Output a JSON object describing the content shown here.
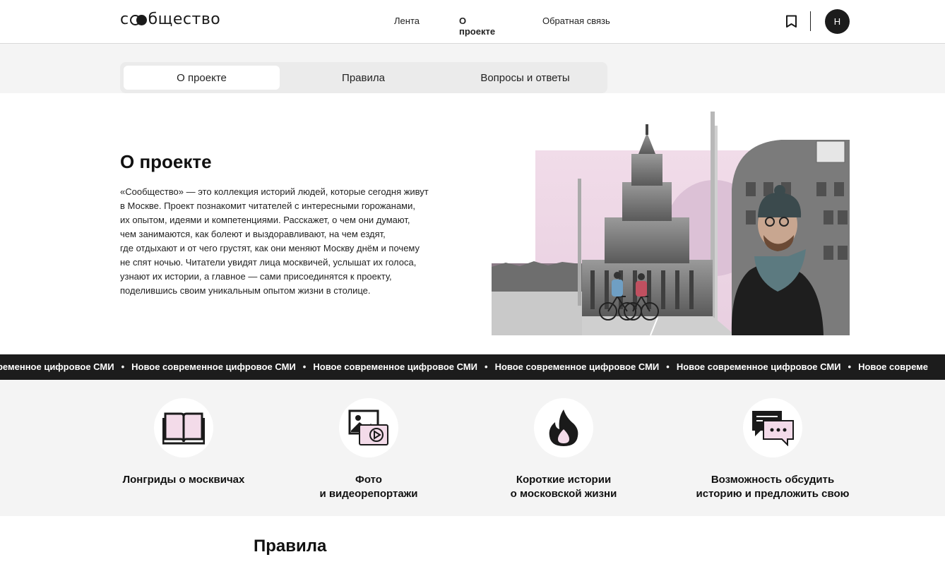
{
  "header": {
    "logo": "сообщество",
    "logo_prefix": "с",
    "logo_suffix": "бщество",
    "nav": [
      "Лента",
      "О проекте",
      "Обратная связь"
    ],
    "avatar_initial": "Н"
  },
  "tabs": [
    "О проекте",
    "Правила",
    "Вопросы и ответы"
  ],
  "about": {
    "title": "О проекте",
    "text_lines": [
      "«Сообщество» — это коллекция историй людей, которые сегодня живут",
      "в Москве. Проект познакомит читателей с интересными горожанами,",
      "их опытом, идеями и компетенциями. Расскажет, о чем они думают,",
      "чем занимаются, как болеют и выздоравливают, на чем ездят,",
      "где отдыхают и от чего грустят, как они меняют Москву днём и почему",
      "не спят ночью. Читатели увидят лица москвичей, услышат их голоса,",
      "узнают их истории, а главное — сами присоединятся к проекту,",
      "поделившись своим уникальным опытом жизни в столице."
    ]
  },
  "marquee": {
    "items": [
      "временное цифровое СМИ",
      "Новое современное цифровое СМИ",
      "Новое современное цифровое СМИ",
      "Новое современное цифровое СМИ",
      "Новое современное цифровое СМИ",
      "Новое совреме"
    ],
    "separator": "•"
  },
  "features": [
    {
      "icon": "book-icon",
      "line1": "Лонгриды о москвичах",
      "line2": ""
    },
    {
      "icon": "photo-video-icon",
      "line1": "Фото",
      "line2": "и видеорепортажи"
    },
    {
      "icon": "fire-icon",
      "line1": "Короткие истории",
      "line2": "о московской жизни"
    },
    {
      "icon": "chat-icon",
      "line1": "Возможность обсудить",
      "line2": "историю и предложить свою"
    }
  ],
  "rules": {
    "title": "Правила"
  },
  "colors": {
    "accent_pink": "#f3dbe9",
    "dark": "#1c1c1c",
    "band": "#f4f4f4"
  }
}
